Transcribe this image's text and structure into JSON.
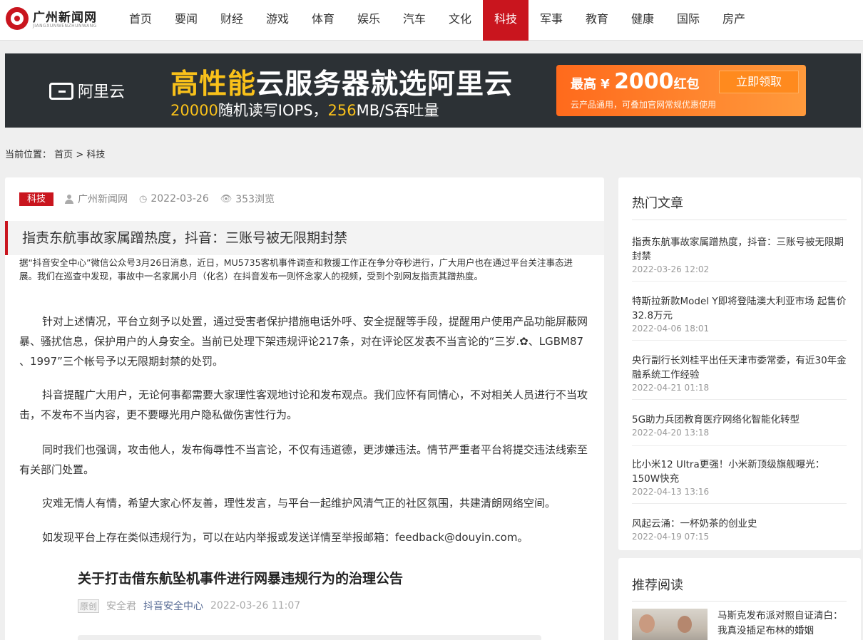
{
  "site": {
    "logo_name": "广州新闻网",
    "logo_sub": "JIANGXUNWENZHUNWANG"
  },
  "nav": {
    "items": [
      "首页",
      "要闻",
      "财经",
      "游戏",
      "体育",
      "娱乐",
      "汽车",
      "文化",
      "科技",
      "军事",
      "教育",
      "健康",
      "国际",
      "房产"
    ],
    "active": "科技"
  },
  "banner": {
    "brand": "阿里云",
    "title_highlight": "高性能",
    "title_rest": "云服务器就选阿里云",
    "sub_num1": "20000",
    "sub_text1": "随机读写IOPS，",
    "sub_num2": "256",
    "sub_text2": "MB/S吞吐量",
    "promo_prefix": "最高 ¥ ",
    "promo_amount": "2000",
    "promo_suffix": "红包",
    "promo_button": "立即领取",
    "promo_note": "云产品通用，可叠加官网常规优惠使用"
  },
  "breadcrumb": {
    "prefix": "当前位置：",
    "home": "首页",
    "sep": ">",
    "current": "科技"
  },
  "article": {
    "tag": "科技",
    "author": "广州新闻网",
    "date": "2022-03-26",
    "views": "353浏览",
    "title": "指责东航事故家属蹭热度，抖音：三账号被无限期封禁",
    "summary": "据“抖音安全中心”微信公众号3月26日消息，近日，MU5735客机事件调查和救援工作正在争分夺秒进行，广大用户也在通过平台关注事态进展。我们在巡查中发现，事故中一名家属小月（化名）在抖音发布一则怀念家人的视频，受到个别网友指责其蹭热度。",
    "paragraphs": [
      "针对上述情况，平台立刻予以处置，通过受害者保护措施电话外呼、安全提醒等手段，提醒用户使用产品功能屏蔽网暴、骚扰信息，保护用户的人身安全。当前已处理下架违规评论217条，对在评论区发表不当言论的“三岁.✿、LGBM87 、1997”三个帐号予以无限期封禁的处罚。",
      "抖音提醒广大用户，无论何事都需要大家理性客观地讨论和发布观点。我们应怀有同情心，不对相关人员进行不当攻击，不发布不当内容，更不要曝光用户隐私做伤害性行为。",
      "同时我们也强调，攻击他人，发布侮辱性不当言论，不仅有违道德，更涉嫌违法。情节严重者平台将提交违法线索至有关部门处置。",
      "灾难无情人有情，希望大家心怀友善，理性发言，与平台一起维护风清气正的社区氛围，共建清朗网络空间。",
      "如发现平台上存在类似违规行为，可以在站内举报或发送详情至举报邮箱：feedback@douyin.com。"
    ],
    "notice": {
      "title": "关于打击借东航坠机事件进行网暴违规行为的治理公告",
      "badge": "原创",
      "author": "安全君",
      "source": "抖音安全中心",
      "datetime": "2022-03-26 11:07"
    }
  },
  "hot": {
    "title": "热门文章",
    "items": [
      {
        "title": "指责东航事故家属蹭热度，抖音：三账号被无限期封禁",
        "date": "2022-03-26 12:02"
      },
      {
        "title": "特斯拉新款Model Y即将登陆澳大利亚市场 起售价32.8万元",
        "date": "2022-04-06 18:01"
      },
      {
        "title": "央行副行长刘桂平出任天津市委常委，有近30年金融系统工作经验",
        "date": "2022-04-21 01:18"
      },
      {
        "title": "5G助力兵团教育医疗网络化智能化转型",
        "date": "2022-04-20 13:18"
      },
      {
        "title": "比小米12 Ultra更强！小米新顶级旗舰曝光：150W快充",
        "date": "2022-04-13 13:16"
      },
      {
        "title": "风起云涌：一杯奶茶的创业史",
        "date": "2022-04-19 07:15"
      }
    ]
  },
  "recommend": {
    "title": "推荐阅读",
    "items": [
      {
        "title": "马斯克发布派对照自证清白：我真没插足布林的婚姻"
      }
    ]
  },
  "colors": {
    "accent": "#c9151e",
    "banner_bg": "#2c3135",
    "banner_yellow": "#f9c11a",
    "promo_orange": "#ff7a22"
  }
}
